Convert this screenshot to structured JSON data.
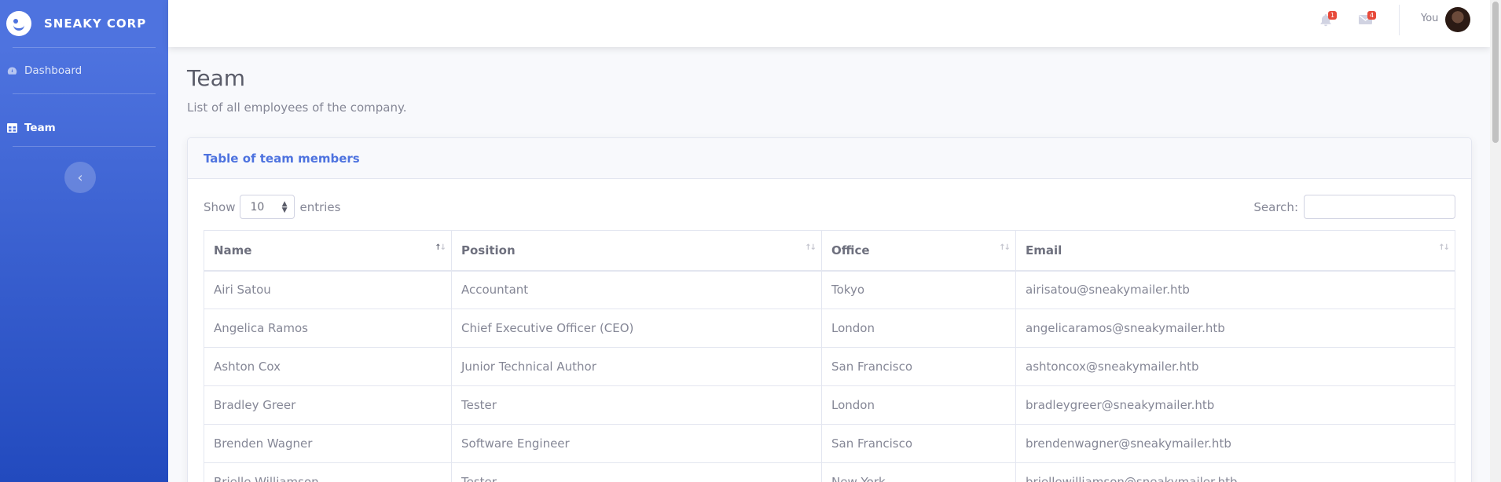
{
  "brand": {
    "name": "SNEAKY CORP"
  },
  "sidebar": {
    "items": [
      {
        "label": "Dashboard",
        "icon": "tachometer-icon"
      },
      {
        "label": "Team",
        "icon": "table-icon"
      }
    ],
    "toggle_icon": "chevron-left-icon"
  },
  "topbar": {
    "alerts_count": "1",
    "messages_count": "4",
    "user_name": "You"
  },
  "page": {
    "title": "Team",
    "subtitle": "List of all employees of the company."
  },
  "card": {
    "title": "Table of team members",
    "show_label": "Show",
    "entries_value": "10",
    "entries_label": "entries",
    "search_label": "Search:",
    "search_value": ""
  },
  "table": {
    "columns": [
      "Name",
      "Position",
      "Office",
      "Email"
    ],
    "rows": [
      [
        "Airi Satou",
        "Accountant",
        "Tokyo",
        "airisatou@sneakymailer.htb"
      ],
      [
        "Angelica Ramos",
        "Chief Executive Officer (CEO)",
        "London",
        "angelicaramos@sneakymailer.htb"
      ],
      [
        "Ashton Cox",
        "Junior Technical Author",
        "San Francisco",
        "ashtoncox@sneakymailer.htb"
      ],
      [
        "Bradley Greer",
        "Tester",
        "London",
        "bradleygreer@sneakymailer.htb"
      ],
      [
        "Brenden Wagner",
        "Software Engineer",
        "San Francisco",
        "brendenwagner@sneakymailer.htb"
      ],
      [
        "Brielle Williamson",
        "Tester",
        "New York",
        "briellewilliamson@sneakymailer.htb"
      ]
    ]
  },
  "colors": {
    "primary": "#4e73df",
    "sidebar_dark": "#224abe",
    "badge": "#e74a3b",
    "text": "#858796"
  }
}
